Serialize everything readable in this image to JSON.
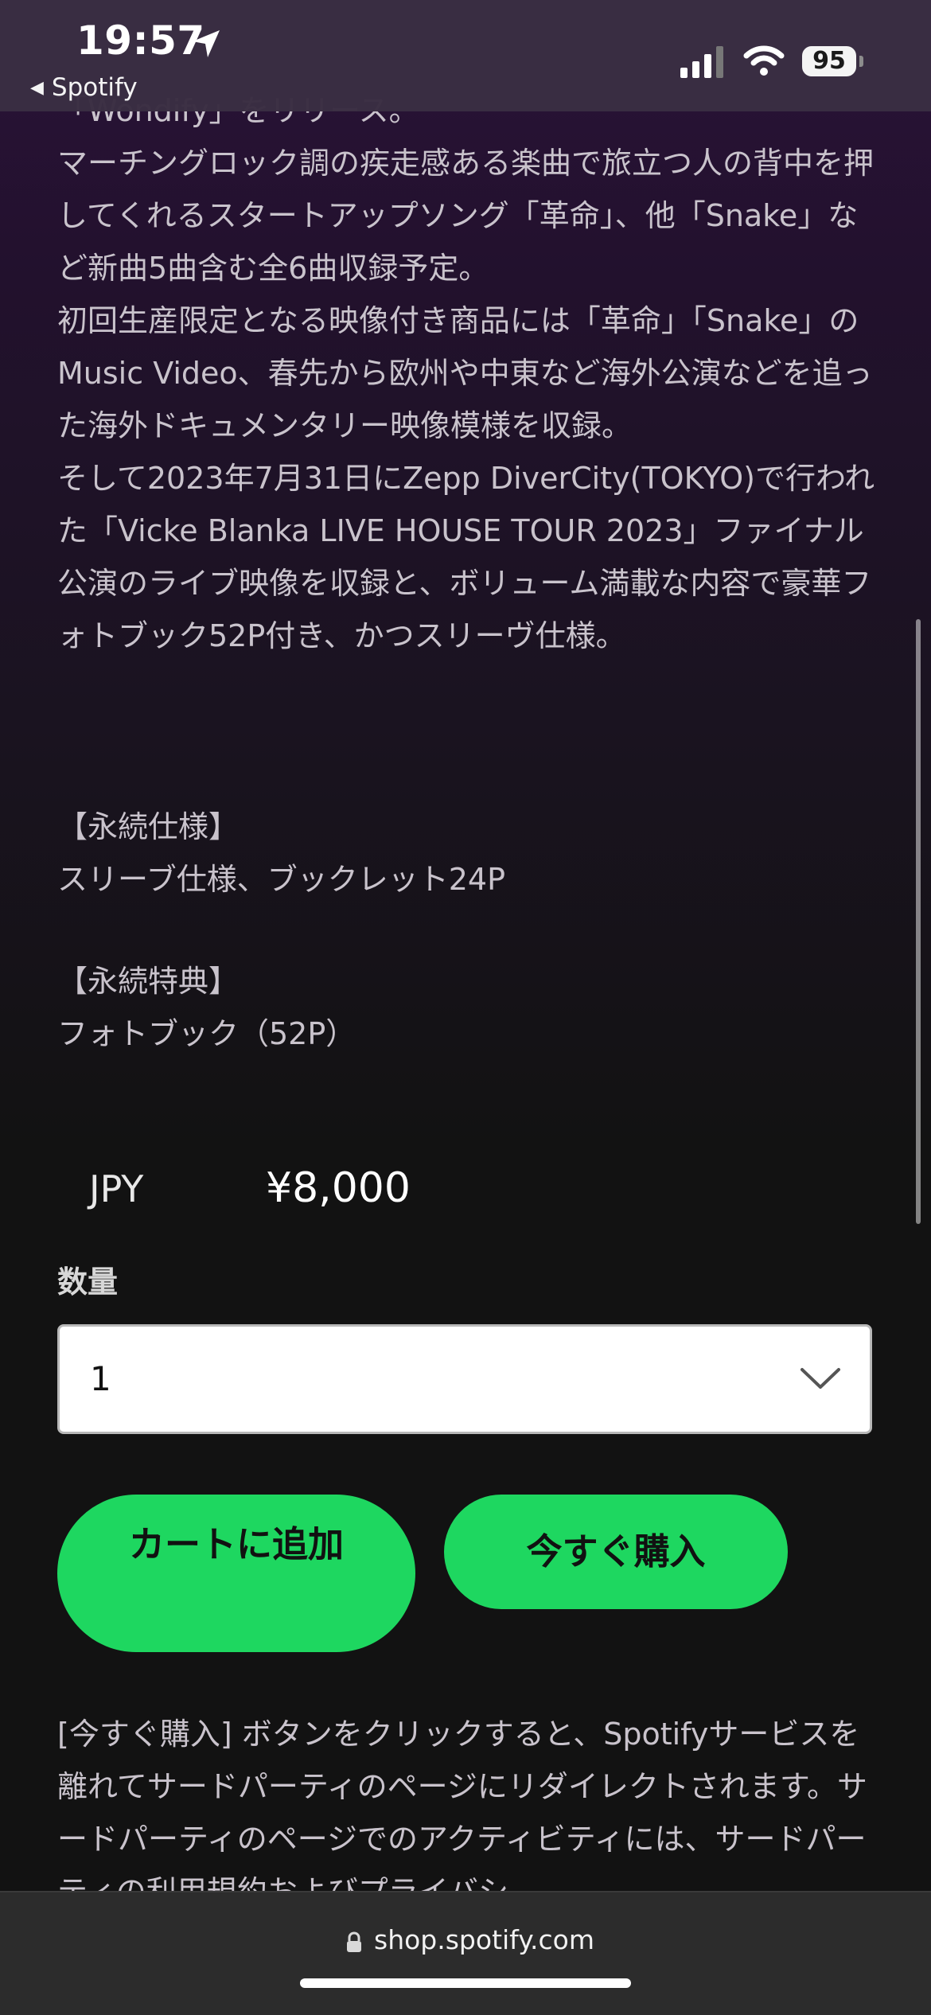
{
  "status_bar": {
    "time": "19:57",
    "back_app": "Spotify",
    "battery": "95"
  },
  "description": {
    "lines": [
      "「Wondify」をリリース。",
      "マーチングロック調の疾走感ある楽曲で旅立つ人の背中を押してくれるスタートアップソング「革命」、他「Snake」など新曲5曲含む全6曲収録予定。",
      "初回生産限定となる映像付き商品には「革命」「Snake」のMusic Video、春先から欧州や中東など海外公演などを追った海外ドキュメンタリー映像模様を収録。",
      "そして2023年7月31日にZepp DiverCity(TOKYO)で行われた「Vicke Blanka LIVE HOUSE TOUR 2023」ファイナル公演のライブ映像を収録と、ボリューム満載な内容で豪華フォトブック52P付き、かつスリーヴ仕様。"
    ]
  },
  "specs": {
    "spec_title": "【永続仕様】",
    "spec_value": "スリーブ仕様、ブックレット24P",
    "bonus_title": "【永続特典】",
    "bonus_value": "フォトブック（52P）"
  },
  "price": {
    "currency": "JPY",
    "amount": "¥8,000"
  },
  "quantity": {
    "label": "数量",
    "selected": "1"
  },
  "buttons": {
    "add_to_cart": "カートに追加",
    "buy_now": "今すぐ購入"
  },
  "notice": "[今すぐ購入] ボタンをクリックすると、Spotifyサービスを離れてサードパーティのページにリダイレクトされます。サードパーティのページでのアクティビティには、サードパーティの利用規約およびプライバシ",
  "browser": {
    "address": "shop.spotify.com"
  }
}
